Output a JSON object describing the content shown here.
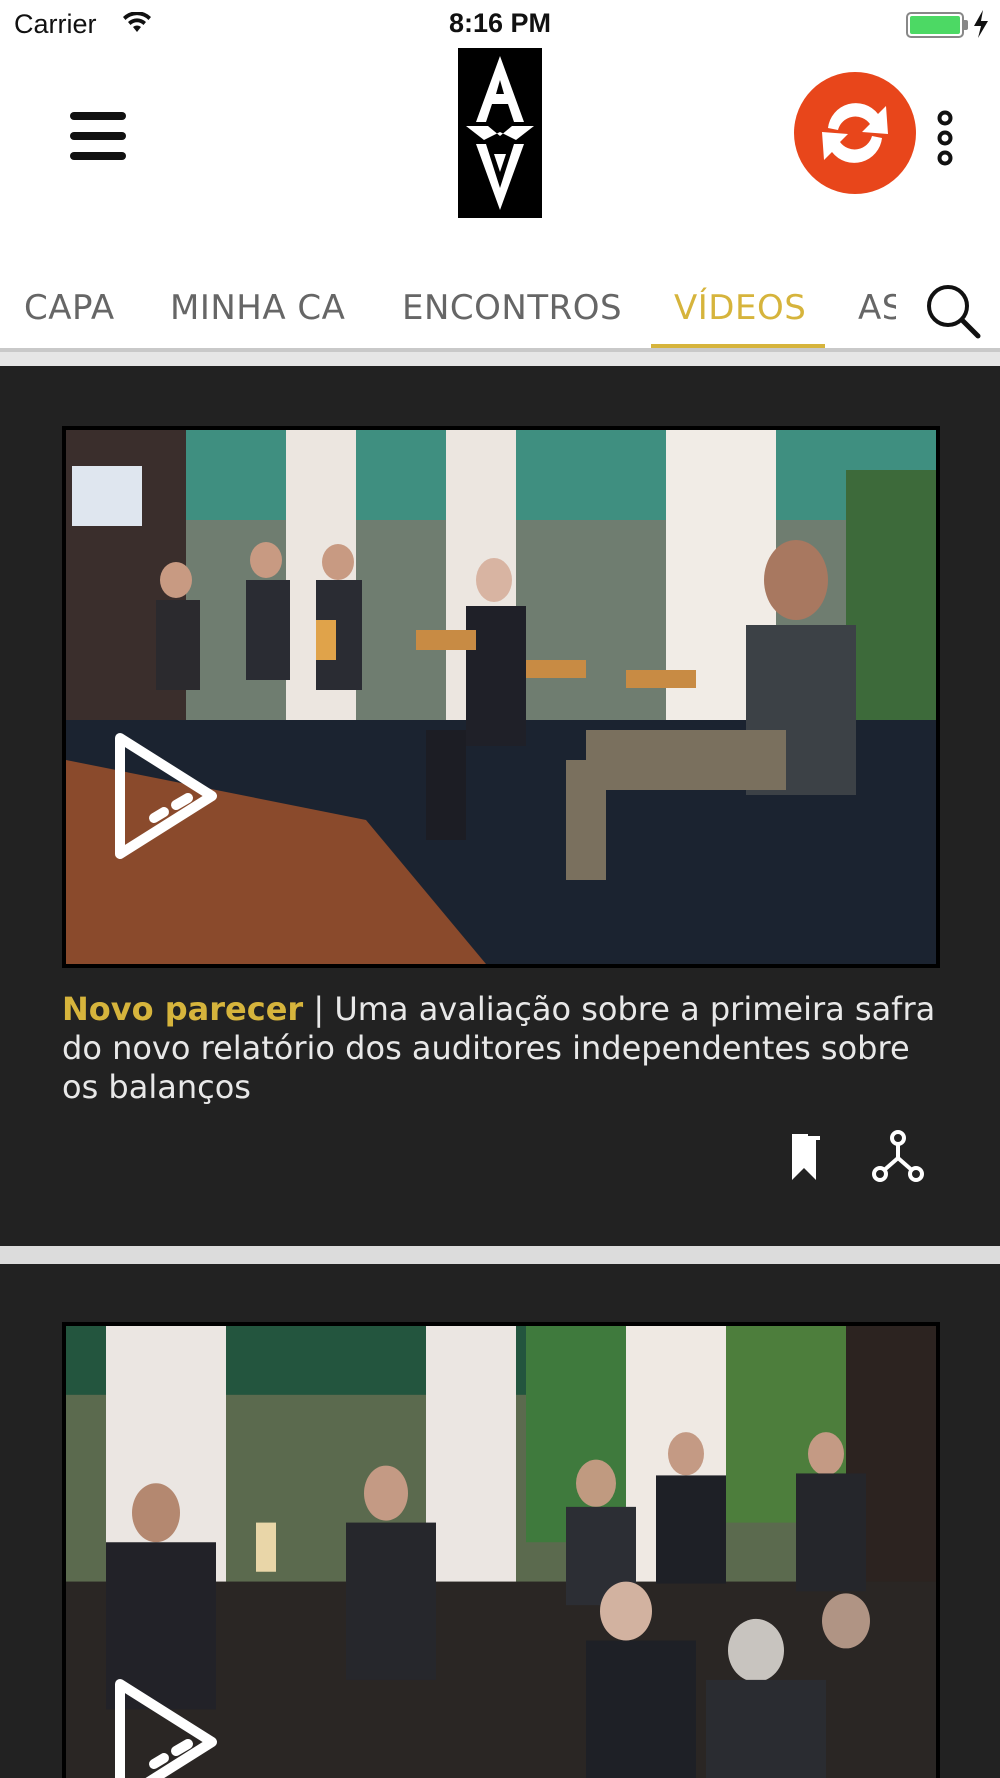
{
  "status_bar": {
    "carrier": "Carrier",
    "time": "8:16 PM",
    "wifi_icon": "wifi-icon",
    "battery_icon": "battery-icon",
    "battery_color": "#4cd964",
    "charging_icon": "bolt-icon"
  },
  "header": {
    "menu_icon": "hamburger-menu-icon",
    "logo_icon": "av-logo-icon",
    "sync_icon": "sync-icon",
    "sync_color": "#e8461b",
    "more_icon": "vertical-ellipsis-icon"
  },
  "tabs": {
    "items": [
      {
        "label": "CAPA",
        "active": false
      },
      {
        "label": "MINHA CA",
        "active": false
      },
      {
        "label": "ENCONTROS",
        "active": false
      },
      {
        "label": "VÍDEOS",
        "active": true
      },
      {
        "label": "AS",
        "active": false
      }
    ],
    "accent_color": "#d6b43c",
    "search_icon": "search-icon"
  },
  "videos": [
    {
      "kicker": "Novo parecer",
      "separator": " | ",
      "title": "Uma avaliação sobre a primeira safra do novo relatório dos auditores independentes sobre os balanços",
      "play_icon": "play-icon",
      "bookmark_icon": "bookmark-icon",
      "share_icon": "share-icon"
    },
    {
      "play_icon": "play-icon"
    }
  ]
}
